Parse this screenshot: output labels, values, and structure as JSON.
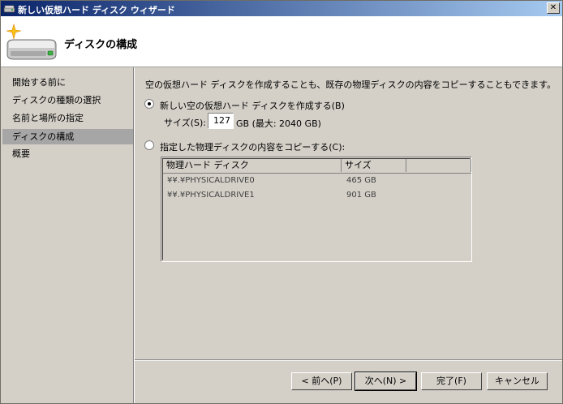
{
  "window": {
    "title": "新しい仮想ハード ディスク ウィザード",
    "close_glyph": "✕"
  },
  "header": {
    "title": "ディスクの構成",
    "icon": "disk-wizard-icon"
  },
  "nav": {
    "items": [
      {
        "label": "開始する前に"
      },
      {
        "label": "ディスクの種類の選択"
      },
      {
        "label": "名前と場所の指定"
      },
      {
        "label": "ディスクの構成",
        "active": true
      },
      {
        "label": "概要"
      }
    ]
  },
  "main": {
    "intro": "空の仮想ハード ディスクを作成することも、既存の物理ディスクの内容をコピーすることもできます。",
    "option_new": {
      "label": "新しい空の仮想ハード ディスクを作成する(B)",
      "selected": true
    },
    "size": {
      "label": "サイズ(S):",
      "value": "127",
      "note": "GB (最大: 2040 GB)"
    },
    "option_copy": {
      "label": "指定した物理ディスクの内容をコピーする(C):",
      "selected": false
    },
    "disk_list": {
      "columns": [
        "物理ハード ディスク",
        "サイズ"
      ],
      "rows": [
        {
          "name": "¥¥.¥PHYSICALDRIVE0",
          "size": "465 GB"
        },
        {
          "name": "¥¥.¥PHYSICALDRIVE1",
          "size": "901 GB"
        }
      ]
    }
  },
  "footer": {
    "prev_label": "< 前へ(P)",
    "next_label": "次へ(N) >",
    "finish_label": "完了(F)",
    "cancel_label": "キャンセル"
  }
}
